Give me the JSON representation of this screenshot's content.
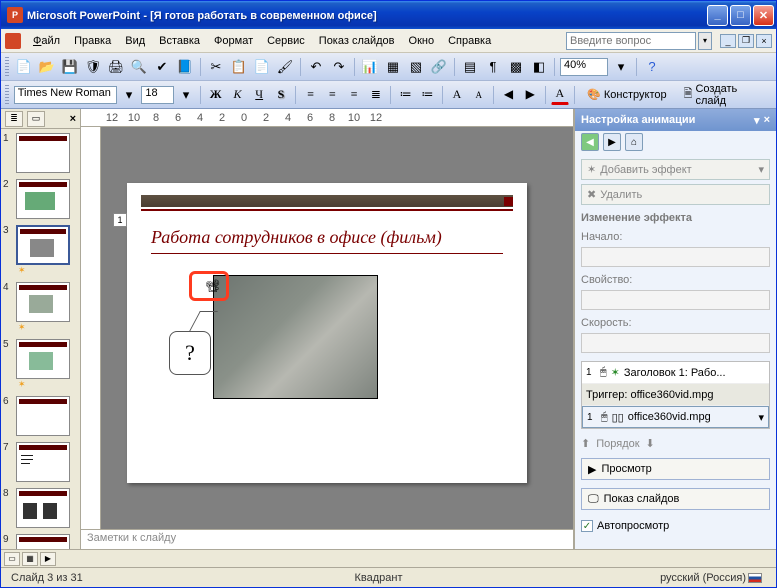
{
  "window": {
    "app": "Microsoft PowerPoint",
    "doc": "[Я готов работать в современном офисе]"
  },
  "menu": {
    "file": "Файл",
    "edit": "Правка",
    "view": "Вид",
    "insert": "Вставка",
    "format": "Формат",
    "tools": "Сервис",
    "slideshow": "Показ слайдов",
    "window": "Окно",
    "help": "Справка"
  },
  "ask": {
    "placeholder": "Введите вопрос"
  },
  "toolbar": {
    "zoom": "40%"
  },
  "format": {
    "font": "Times New Roman",
    "size": "18",
    "bold": "Ж",
    "italic": "К",
    "underline": "Ч",
    "shadow": "S",
    "designer": "Конструктор",
    "newslide": "Создать слайд"
  },
  "outline": {
    "close": "×",
    "slides": [
      "1",
      "2",
      "3",
      "4",
      "5",
      "6",
      "7",
      "8",
      "9"
    ],
    "selected": "3"
  },
  "slide": {
    "num": "1",
    "title": "Работа сотрудников в офисе (фильм)",
    "callout": "?"
  },
  "notes": {
    "placeholder": "Заметки к слайду"
  },
  "taskpane": {
    "title": "Настройка анимации",
    "add": "Добавить эффект",
    "del": "Удалить",
    "change_head": "Изменение эффекта",
    "start": "Начало:",
    "prop": "Свойство:",
    "speed": "Скорость:",
    "row1": "Заголовок 1: Рабо...",
    "trigger": "Триггер: office360vid.mpg",
    "row2": "office360vid.mpg",
    "order": "Порядок",
    "preview": "Просмотр",
    "show": "Показ слайдов",
    "auto": "Автопросмотр",
    "n1": "1",
    "n2": "1"
  },
  "status": {
    "slide": "Слайд 3 из 31",
    "theme": "Квадрант",
    "lang": "русский (Россия)"
  }
}
